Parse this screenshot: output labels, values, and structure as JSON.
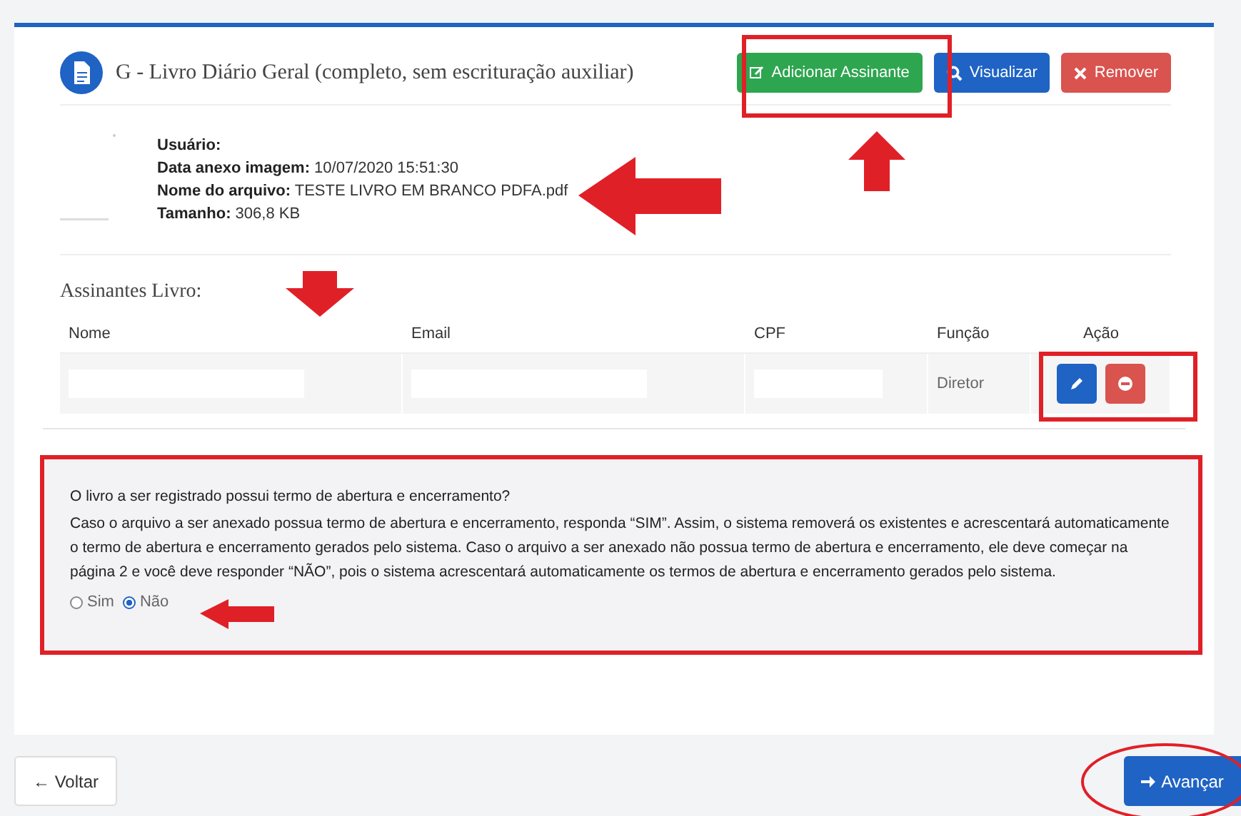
{
  "document": {
    "title": "G - Livro Diário Geral (completo, sem escrituração auxiliar)",
    "buttons": [
      {
        "kind": "add",
        "label": "Adicionar Assinante"
      },
      {
        "kind": "view",
        "label": "Visualizar"
      },
      {
        "kind": "remove",
        "label": "Remover"
      }
    ],
    "info": [
      {
        "label": "Usuário:"
      },
      {
        "label": "Data anexo imagem:",
        "value": "10/07/2020 15:51:30"
      },
      {
        "label": "Nome do arquivo:",
        "value": "TESTE LIVRO EM BRANCO PDFA.pdf"
      },
      {
        "label": "Tamanho:",
        "value": "306,8 KB"
      }
    ]
  },
  "signers": {
    "title": "Assinantes Livro:",
    "columns": [
      "Nome",
      "Email",
      "CPF",
      "Função",
      "Ação"
    ],
    "rows": [
      {
        "funcao": "Diretor"
      }
    ]
  },
  "question": {
    "title": "O livro a ser registrado possui termo de abertura e encerramento?",
    "text": "Caso o arquivo a ser anexado possua termo de abertura e encerramento, responda “SIM”. Assim, o sistema removerá os existentes e acrescentará automaticamente o termo de abertura e encerramento gerados pelo sistema. Caso o arquivo a ser anexado não possua termo de abertura e encerramento, ele deve começar na página 2 e você deve responder “NÃO”, pois o sistema acrescentará automaticamente os termos de abertura e encerramento gerados pelo sistema.",
    "options": [
      {
        "label": "Sim",
        "selected": false
      },
      {
        "label": "Não",
        "selected": true
      }
    ]
  },
  "footer": {
    "back": "← Voltar",
    "next": "Avançar"
  }
}
